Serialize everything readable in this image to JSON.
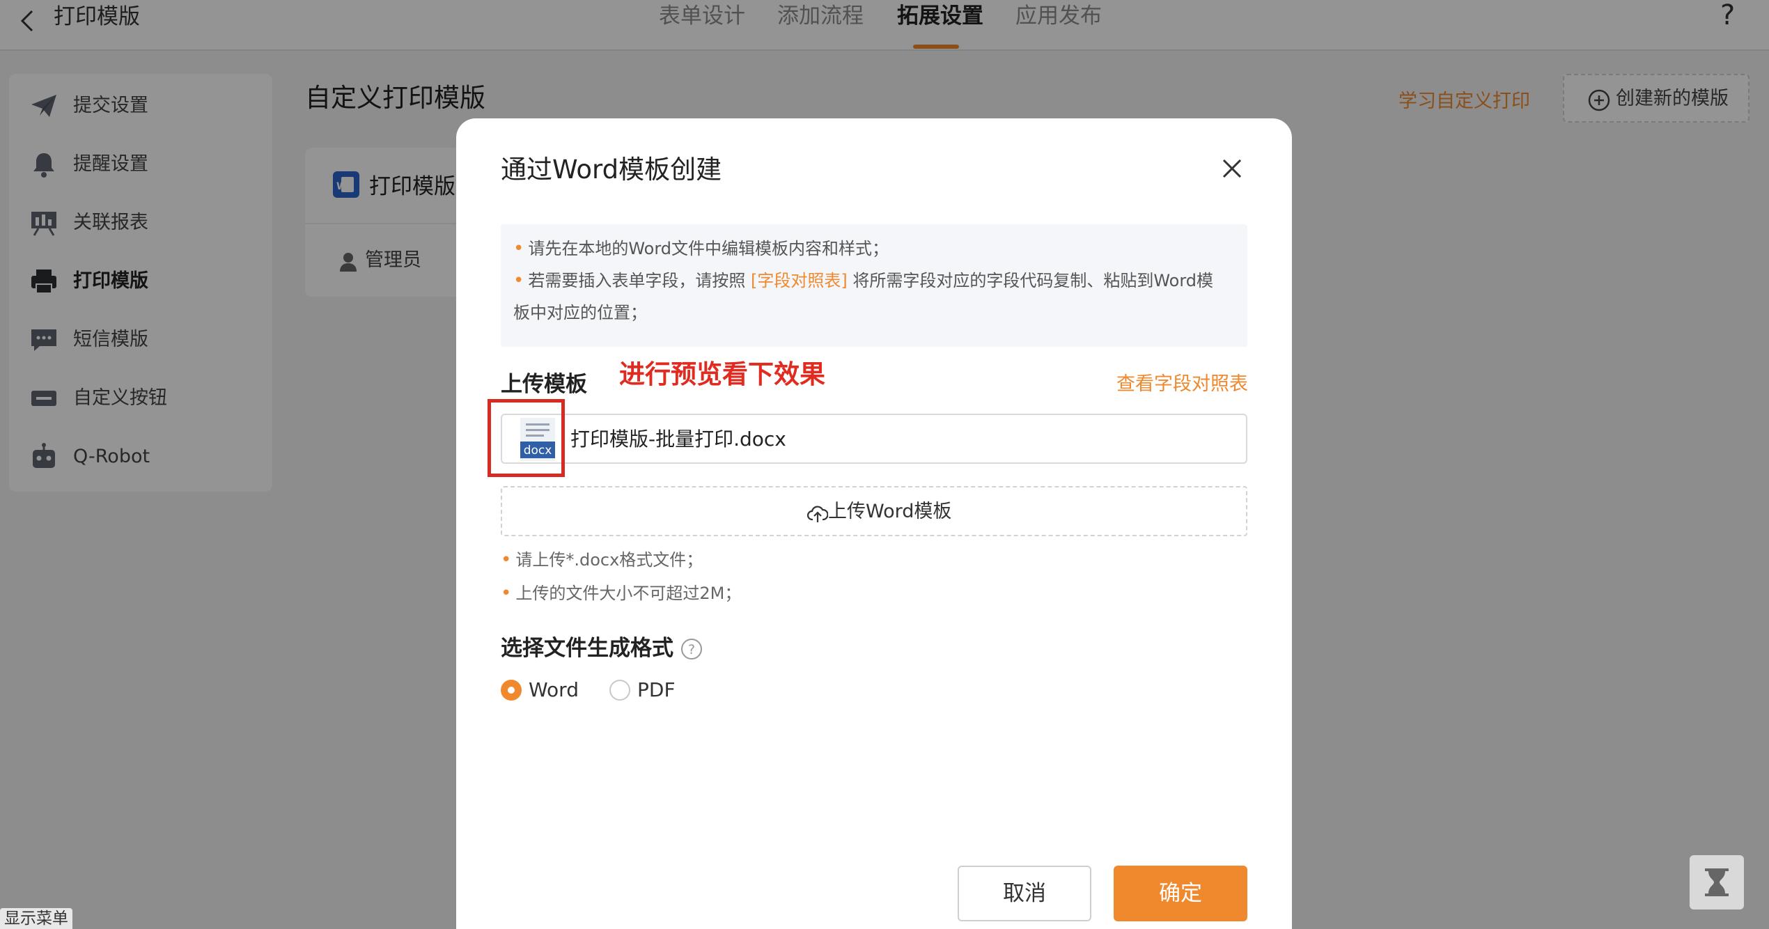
{
  "header": {
    "back_label": "打印模版",
    "tabs": [
      "表单设计",
      "添加流程",
      "拓展设置",
      "应用发布"
    ],
    "active_tab": "拓展设置",
    "help_symbol": "?"
  },
  "sidebar": {
    "items": [
      {
        "label": "提交设置",
        "icon": "paper-plane-icon"
      },
      {
        "label": "提醒设置",
        "icon": "bell-icon"
      },
      {
        "label": "关联报表",
        "icon": "report-icon"
      },
      {
        "label": "打印模版",
        "icon": "printer-icon"
      },
      {
        "label": "短信模版",
        "icon": "sms-icon"
      },
      {
        "label": "自定义按钮",
        "icon": "custom-button-icon"
      },
      {
        "label": "Q-Robot",
        "icon": "robot-icon"
      }
    ],
    "active": "打印模版"
  },
  "main": {
    "title": "自定义打印模版",
    "learn_link": "学习自定义打印",
    "create_button": "创建新的模版",
    "card": {
      "title": "打印模版",
      "owner": "管理员"
    }
  },
  "modal": {
    "title": "通过Word模板创建",
    "tips": {
      "line1": "请先在本地的Word文件中编辑模板内容和样式；",
      "line2_prefix": "若需要插入表单字段，请按照",
      "line2_link": "[字段对照表]",
      "line2_suffix": "将所需字段对应的字段代码复制、粘贴到Word模",
      "line3": "板中对应的位置；"
    },
    "upload_label": "上传模板",
    "annotation": "进行预览看下效果",
    "field_map_link": "查看字段对照表",
    "file_icon_text": "docx",
    "file_name": "打印模版-批量打印.docx",
    "upload_button": "上传Word模板",
    "rules": [
      "请上传*.docx格式文件；",
      "上传的文件大小不可超过2M；"
    ],
    "format_label": "选择文件生成格式",
    "format_options": [
      "Word",
      "PDF"
    ],
    "format_selected": "Word",
    "cancel_button": "取消",
    "confirm_button": "确定"
  },
  "footer": {
    "show_menu": "显示菜单"
  },
  "colors": {
    "accent": "#f0892e",
    "annotation_red": "#d62b20"
  }
}
